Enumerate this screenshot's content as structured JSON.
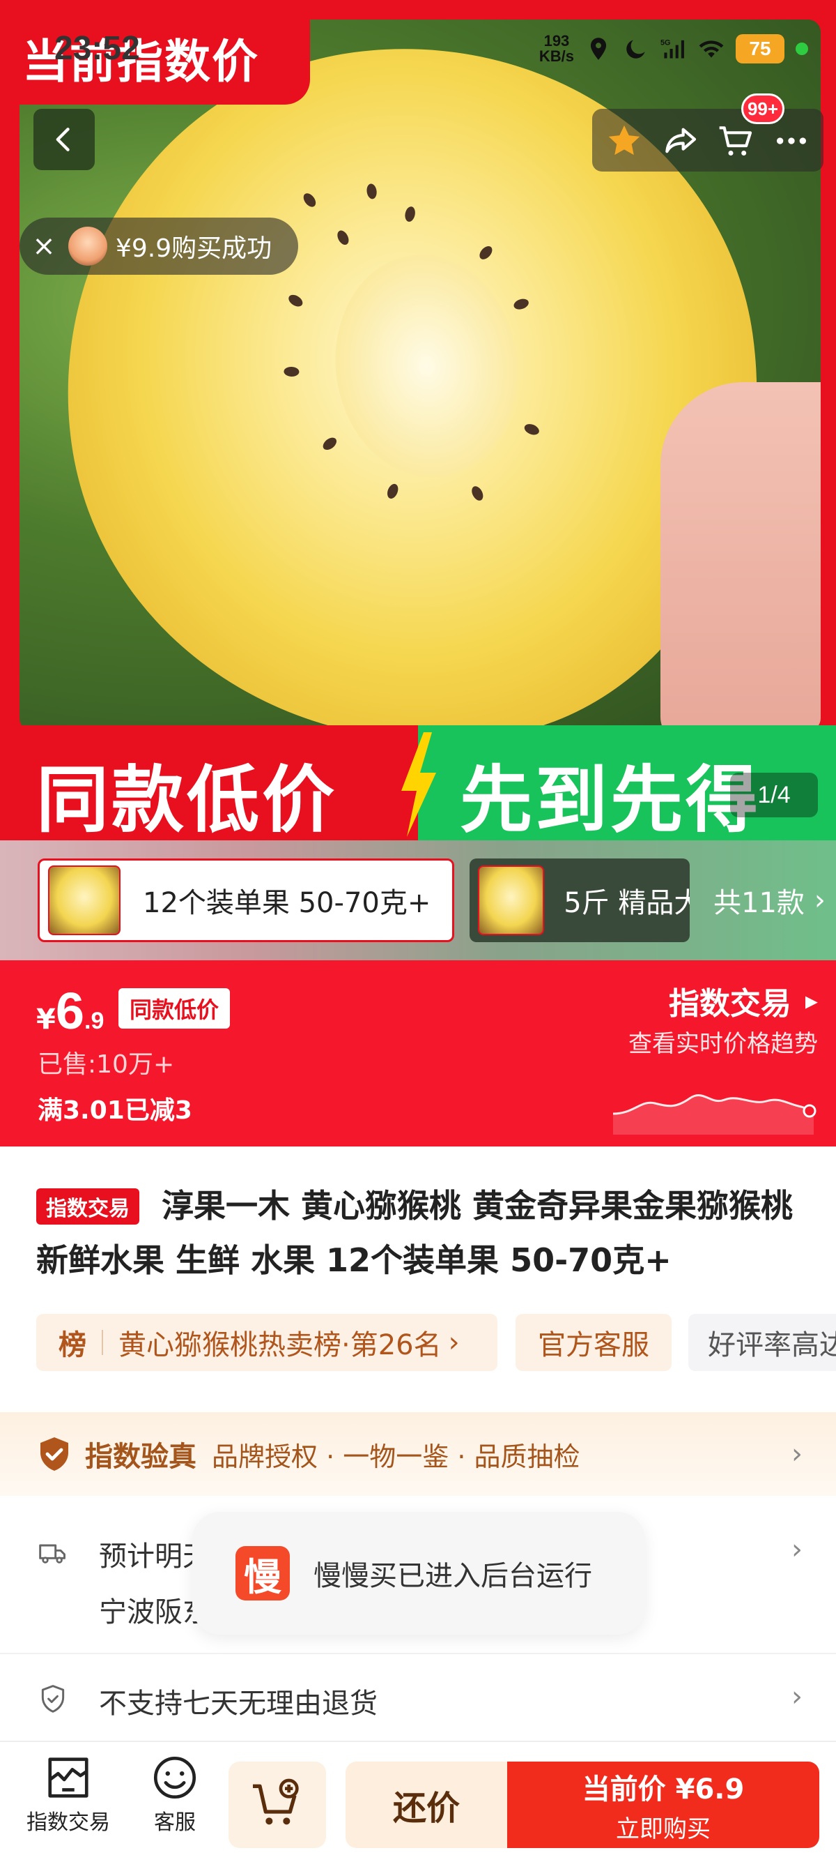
{
  "status_bar": {
    "time": "23:52",
    "speed_value": "193",
    "speed_unit": "KB/s",
    "network": "5G",
    "battery": "75"
  },
  "hero": {
    "top_badge": "当前指数价",
    "toast": "¥9.9购买成功",
    "cart_badge": "99+",
    "banner_left": "同款低价",
    "banner_right": "先到先得",
    "page_indicator": "1/4"
  },
  "variants": {
    "items": [
      {
        "label": "12个装单果 50-70克+"
      },
      {
        "label": "5斤 精品大"
      }
    ],
    "more": "共11款"
  },
  "price": {
    "yen": "¥",
    "integer": "6",
    "decimal": ".9",
    "tag": "同款低价",
    "sold": "已售:10万+",
    "discount": "满3.01已减3",
    "index_title": "指数交易",
    "index_sub": "查看实时价格趋势",
    "trend_color": "#ffffff"
  },
  "product": {
    "tag": "指数交易",
    "title": "淳果一木 黄心猕猴桃 黄金奇异果金果猕猴桃 新鲜水果 生鲜 水果 12个装单果 50-70克+",
    "rank_badge": "榜",
    "rank_text": "黄心猕猴桃热卖榜·第26名",
    "service_chip": "官方客服",
    "good_chip": "好评率高达"
  },
  "guarantee": {
    "title": "指数验真",
    "desc": "品牌授权 · 一物一鉴 · 品质抽检"
  },
  "delivery": {
    "line1": "预计明天",
    "line2": "宁波阪东"
  },
  "returns": {
    "text": "不支持七天无理由退货"
  },
  "float_toast": {
    "logo": "慢",
    "text": "慢慢买已进入后台运行"
  },
  "bottom_bar": {
    "index_trade": "指数交易",
    "service": "客服",
    "haggle": "还价",
    "buy_price": "当前价 ¥6.9",
    "buy_action": "立即购买"
  },
  "colors": {
    "brand_red": "#e8101e",
    "banner_green": "#17c35a",
    "accent_brown": "#a4551c"
  }
}
